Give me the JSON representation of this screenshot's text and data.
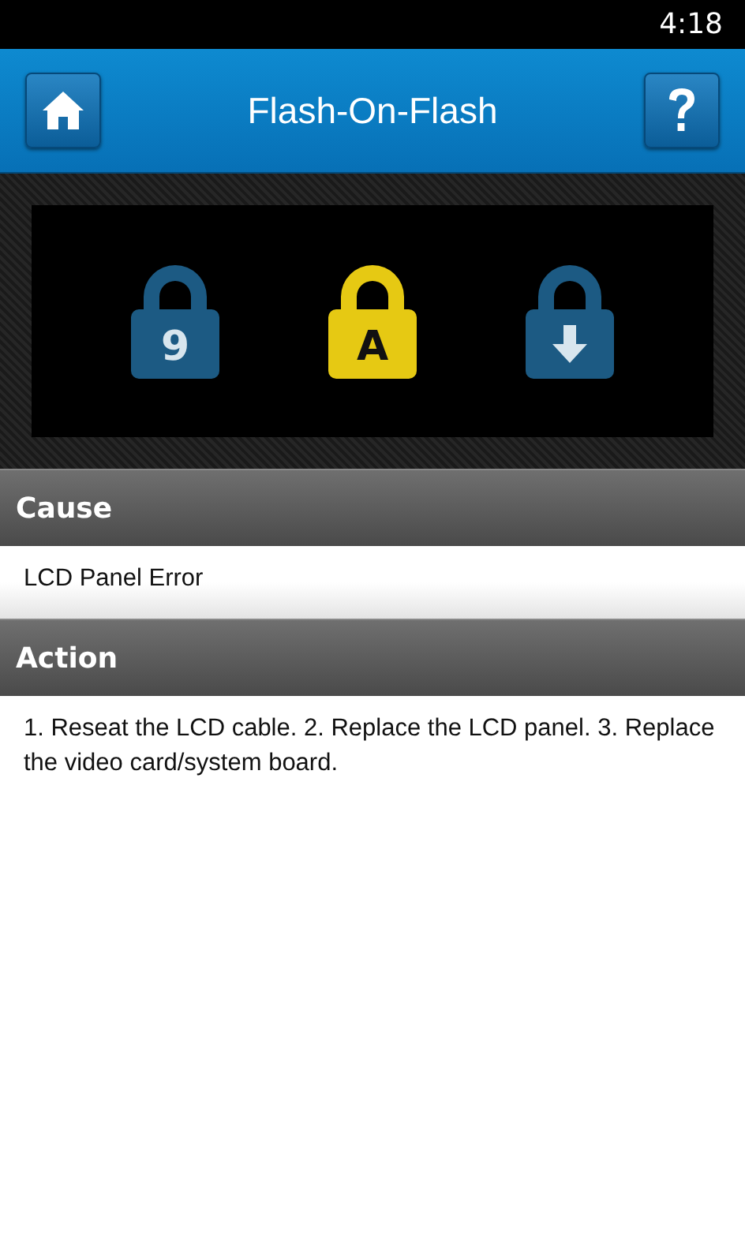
{
  "status_bar": {
    "time": "4:18"
  },
  "header": {
    "title": "Flash-On-Flash"
  },
  "locks": [
    {
      "kind": "text",
      "label": "9",
      "color": "#1c5a83"
    },
    {
      "kind": "text",
      "label": "A",
      "color": "#e6c913"
    },
    {
      "kind": "arrow",
      "color": "#1c5a83"
    }
  ],
  "sections": [
    {
      "heading": "Cause",
      "body": "LCD Panel Error"
    },
    {
      "heading": "Action",
      "body": "1. Reseat the LCD cable. 2. Replace the LCD panel. 3. Replace the video card/system board."
    }
  ]
}
